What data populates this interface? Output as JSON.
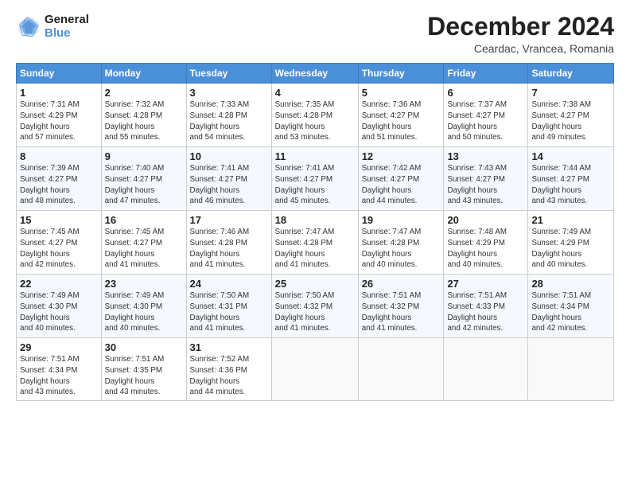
{
  "header": {
    "logo_line1": "General",
    "logo_line2": "Blue",
    "month": "December 2024",
    "location": "Ceardac, Vrancea, Romania"
  },
  "days_of_week": [
    "Sunday",
    "Monday",
    "Tuesday",
    "Wednesday",
    "Thursday",
    "Friday",
    "Saturday"
  ],
  "weeks": [
    [
      {
        "day": "1",
        "rise": "7:31 AM",
        "set": "4:29 PM",
        "hours": "8 hours and 57 minutes."
      },
      {
        "day": "2",
        "rise": "7:32 AM",
        "set": "4:28 PM",
        "hours": "8 hours and 55 minutes."
      },
      {
        "day": "3",
        "rise": "7:33 AM",
        "set": "4:28 PM",
        "hours": "8 hours and 54 minutes."
      },
      {
        "day": "4",
        "rise": "7:35 AM",
        "set": "4:28 PM",
        "hours": "8 hours and 53 minutes."
      },
      {
        "day": "5",
        "rise": "7:36 AM",
        "set": "4:27 PM",
        "hours": "8 hours and 51 minutes."
      },
      {
        "day": "6",
        "rise": "7:37 AM",
        "set": "4:27 PM",
        "hours": "8 hours and 50 minutes."
      },
      {
        "day": "7",
        "rise": "7:38 AM",
        "set": "4:27 PM",
        "hours": "8 hours and 49 minutes."
      }
    ],
    [
      {
        "day": "8",
        "rise": "7:39 AM",
        "set": "4:27 PM",
        "hours": "8 hours and 48 minutes."
      },
      {
        "day": "9",
        "rise": "7:40 AM",
        "set": "4:27 PM",
        "hours": "8 hours and 47 minutes."
      },
      {
        "day": "10",
        "rise": "7:41 AM",
        "set": "4:27 PM",
        "hours": "8 hours and 46 minutes."
      },
      {
        "day": "11",
        "rise": "7:41 AM",
        "set": "4:27 PM",
        "hours": "8 hours and 45 minutes."
      },
      {
        "day": "12",
        "rise": "7:42 AM",
        "set": "4:27 PM",
        "hours": "8 hours and 44 minutes."
      },
      {
        "day": "13",
        "rise": "7:43 AM",
        "set": "4:27 PM",
        "hours": "8 hours and 43 minutes."
      },
      {
        "day": "14",
        "rise": "7:44 AM",
        "set": "4:27 PM",
        "hours": "8 hours and 43 minutes."
      }
    ],
    [
      {
        "day": "15",
        "rise": "7:45 AM",
        "set": "4:27 PM",
        "hours": "8 hours and 42 minutes."
      },
      {
        "day": "16",
        "rise": "7:45 AM",
        "set": "4:27 PM",
        "hours": "8 hours and 41 minutes."
      },
      {
        "day": "17",
        "rise": "7:46 AM",
        "set": "4:28 PM",
        "hours": "8 hours and 41 minutes."
      },
      {
        "day": "18",
        "rise": "7:47 AM",
        "set": "4:28 PM",
        "hours": "8 hours and 41 minutes."
      },
      {
        "day": "19",
        "rise": "7:47 AM",
        "set": "4:28 PM",
        "hours": "8 hours and 40 minutes."
      },
      {
        "day": "20",
        "rise": "7:48 AM",
        "set": "4:29 PM",
        "hours": "8 hours and 40 minutes."
      },
      {
        "day": "21",
        "rise": "7:49 AM",
        "set": "4:29 PM",
        "hours": "8 hours and 40 minutes."
      }
    ],
    [
      {
        "day": "22",
        "rise": "7:49 AM",
        "set": "4:30 PM",
        "hours": "8 hours and 40 minutes."
      },
      {
        "day": "23",
        "rise": "7:49 AM",
        "set": "4:30 PM",
        "hours": "8 hours and 40 minutes."
      },
      {
        "day": "24",
        "rise": "7:50 AM",
        "set": "4:31 PM",
        "hours": "8 hours and 41 minutes."
      },
      {
        "day": "25",
        "rise": "7:50 AM",
        "set": "4:32 PM",
        "hours": "8 hours and 41 minutes."
      },
      {
        "day": "26",
        "rise": "7:51 AM",
        "set": "4:32 PM",
        "hours": "8 hours and 41 minutes."
      },
      {
        "day": "27",
        "rise": "7:51 AM",
        "set": "4:33 PM",
        "hours": "8 hours and 42 minutes."
      },
      {
        "day": "28",
        "rise": "7:51 AM",
        "set": "4:34 PM",
        "hours": "8 hours and 42 minutes."
      }
    ],
    [
      {
        "day": "29",
        "rise": "7:51 AM",
        "set": "4:34 PM",
        "hours": "8 hours and 43 minutes."
      },
      {
        "day": "30",
        "rise": "7:51 AM",
        "set": "4:35 PM",
        "hours": "8 hours and 43 minutes."
      },
      {
        "day": "31",
        "rise": "7:52 AM",
        "set": "4:36 PM",
        "hours": "8 hours and 44 minutes."
      },
      null,
      null,
      null,
      null
    ]
  ]
}
